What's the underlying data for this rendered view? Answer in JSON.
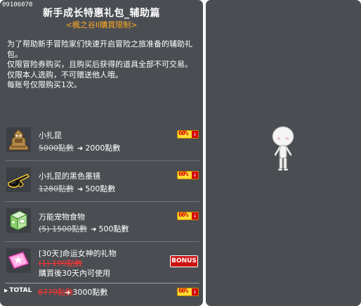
{
  "item_code": "09106070",
  "title": "新手成长特惠礼包_辅助篇",
  "subtitle": "<楓之谷II購買限制>",
  "description": [
    "为了帮助新手冒险家们快速开启冒险之旅准备的辅助礼包。",
    "仅限冒险券购买，且购买后获得的道具全部不可交易。",
    "仅限本人选购，不可赠送他人哦。",
    "每账号仅限购买1次。"
  ],
  "items": [
    {
      "name": "小扎昆",
      "old_price": "5000點數",
      "new_price": "2000點數",
      "badge": "60%",
      "icon": "zakum-figure-icon"
    },
    {
      "name": "小扎昆的黑色墨镜",
      "old_price": "1280點數",
      "new_price": "500點數",
      "badge": "60%",
      "icon": "black-sunglasses-icon"
    },
    {
      "name": "万能宠物食物",
      "old_price": "(5) 1500點數",
      "new_price": "500點數",
      "badge": "66%",
      "icon": "pet-food-box-icon"
    },
    {
      "name": "[30天]命运女神的礼物",
      "old_price": "(1) 199點數",
      "note": "購買後30天內可使用",
      "badge": "BONUS",
      "icon": "pink-gift-ticket-icon"
    }
  ],
  "total": {
    "label": "TOTAL",
    "old_price": "8779點數",
    "new_price": "3000點數",
    "badge": "66%"
  },
  "colors": {
    "panel": "#4a4d52",
    "subtitle": "#ffaa22",
    "strike_red": "#ff3333",
    "badge_bg": "#ffdd33",
    "badge_text": "#d40000"
  }
}
